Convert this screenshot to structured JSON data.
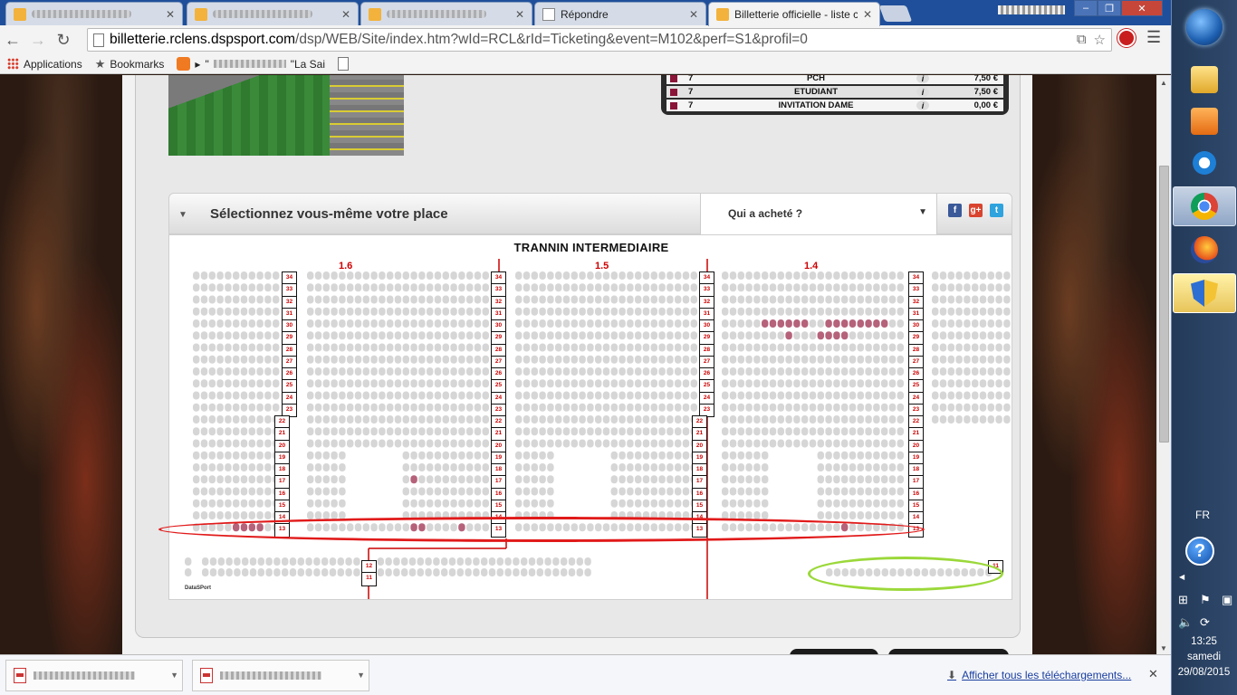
{
  "browser": {
    "tabs": [
      {
        "title": "",
        "blurred": true
      },
      {
        "title": "",
        "blurred": true
      },
      {
        "title": "",
        "blurred": true
      },
      {
        "title": "Répondre",
        "blurred": false
      },
      {
        "title": "Billetterie officielle - liste c",
        "blurred": false,
        "active": true
      }
    ],
    "url_host": "billetterie.rclens.dspsport.com",
    "url_rest": "/dsp/WEB/Site/index.htm?wId=RCL&rId=Ticketing&event=M102&perf=S1&profil=0",
    "bookmarks": {
      "apps": "Applications",
      "bookmarks": "Bookmarks",
      "folder_prefix": "\"",
      "folder_suffix": "\"La Sai"
    },
    "downloads_all": "Afficher tous les téléchargements..."
  },
  "prices": [
    {
      "category": "7",
      "label": "PCH",
      "price": "7,50 €"
    },
    {
      "category": "7",
      "label": "ETUDIANT",
      "price": "7,50 €"
    },
    {
      "category": "7",
      "label": "INVITATION DAME",
      "price": "0,00 €"
    }
  ],
  "selection": {
    "title": "Sélectionnez vous-même votre place",
    "buyers_label": "Qui a acheté ?",
    "map_title": "TRANNIN INTERMEDIAIRE",
    "sections": [
      "1.6",
      "1.5",
      "1.4"
    ],
    "upper_rows": [
      "34",
      "33",
      "32",
      "31",
      "30",
      "29",
      "28",
      "27",
      "26",
      "25",
      "24",
      "23",
      "22",
      "21",
      "20",
      "19",
      "18",
      "17",
      "16",
      "15",
      "14",
      "13"
    ],
    "lower_rows": [
      "12",
      "11"
    ],
    "right_bottom_row": "11",
    "logo": "DataSPort"
  },
  "social": {
    "facebook": "f",
    "gplus": "g+",
    "twitter": "t"
  },
  "colors": {
    "accent_red": "#cc0000",
    "sold": "#b5627a",
    "seat": "#d6d6d6"
  },
  "taskbar": {
    "lang": "FR",
    "time": "13:25",
    "day": "samedi",
    "date": "29/08/2015"
  }
}
